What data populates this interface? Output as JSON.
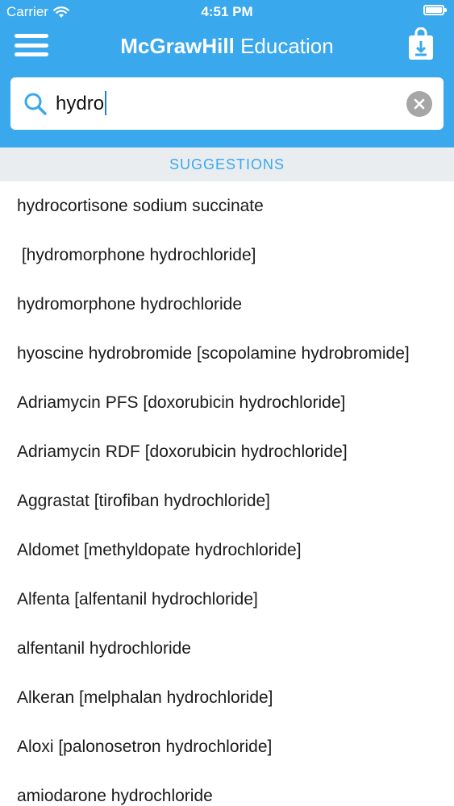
{
  "status_bar": {
    "carrier": "Carrier",
    "time": "4:51 PM"
  },
  "nav": {
    "brand_bold": "McGrawHill",
    "brand_regular": " Education"
  },
  "search": {
    "value": "hydro"
  },
  "suggestions": {
    "header": "SUGGESTIONS",
    "items": [
      "hydrocortisone sodium succinate",
      " [hydromorphone hydrochloride]",
      "hydromorphone hydrochloride",
      "hyoscine hydrobromide [scopolamine hydrobromide]",
      "Adriamycin PFS [doxorubicin hydrochloride]",
      "Adriamycin RDF [doxorubicin hydrochloride]",
      "Aggrastat [tirofiban hydrochloride]",
      "Aldomet [methyldopate hydrochloride]",
      "Alfenta [alfentanil hydrochloride]",
      "alfentanil hydrochloride",
      "Alkeran [melphalan hydrochloride]",
      "Aloxi [palonosetron hydrochloride]",
      "amiodarone hydrochloride"
    ]
  },
  "colors": {
    "header_blue": "#3aa8ec",
    "suggestions_bg": "#e9edf0",
    "clear_grey": "#a6a6a6"
  },
  "icons": {
    "menu": "hamburger-icon",
    "download": "download-bag-icon",
    "search": "search-icon",
    "clear": "clear-icon",
    "wifi": "wifi-icon",
    "battery": "battery-icon"
  }
}
